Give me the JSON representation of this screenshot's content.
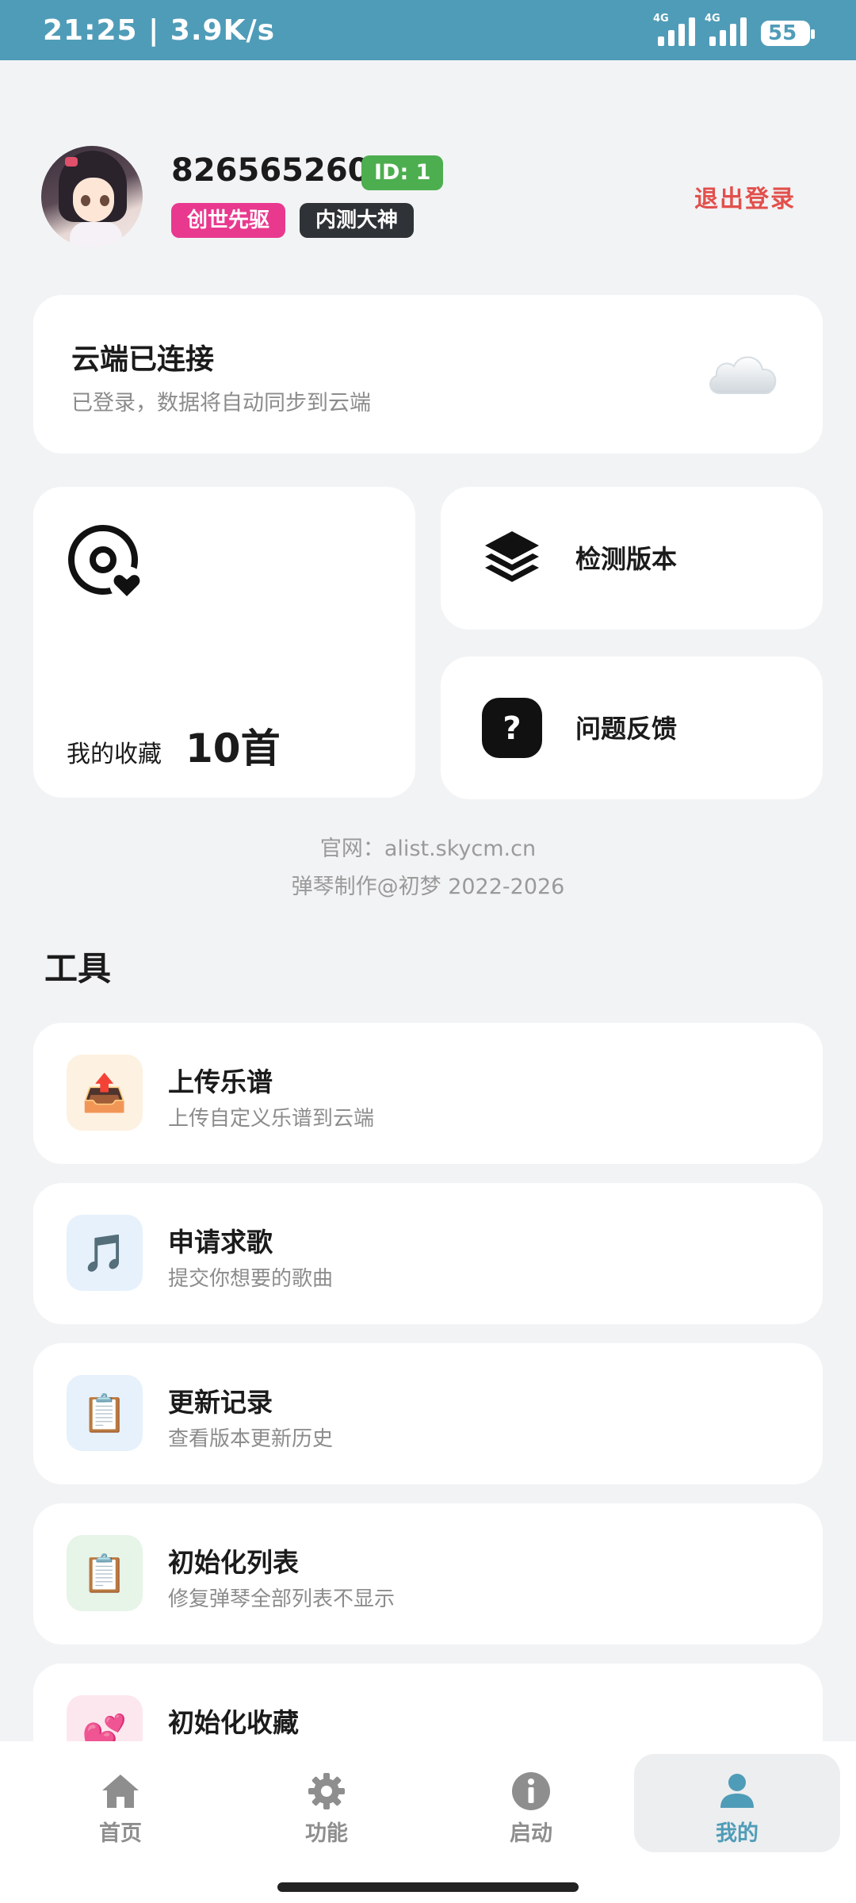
{
  "status_bar": {
    "time": "21:25 | 3.9K/s",
    "network_1": "4G",
    "network_2": "4G",
    "battery": "55"
  },
  "profile": {
    "username": "826565260",
    "id_badge": "ID: 1",
    "badges": [
      "创世先驱",
      "内测大神"
    ],
    "logout_label": "退出登录"
  },
  "cloud": {
    "title": "云端已连接",
    "subtitle": "已登录，数据将自动同步到云端"
  },
  "favorites": {
    "label": "我的收藏",
    "count": "10首"
  },
  "quick_actions": {
    "check_version": "检测版本",
    "feedback": "问题反馈"
  },
  "footer": {
    "website": "官网：alist.skycm.cn",
    "copyright": "弹琴制作@初梦 2022-2026"
  },
  "tools": {
    "section_title": "工具",
    "items": [
      {
        "title": "上传乐谱",
        "subtitle": "上传自定义乐谱到云端",
        "icon": "📤",
        "bg": "#fdf1e2"
      },
      {
        "title": "申请求歌",
        "subtitle": "提交你想要的歌曲",
        "icon": "🎵",
        "bg": "#e6f1fb"
      },
      {
        "title": "更新记录",
        "subtitle": "查看版本更新历史",
        "icon": "📋",
        "bg": "#e6f1fb"
      },
      {
        "title": "初始化列表",
        "subtitle": "修复弹琴全部列表不显示",
        "icon": "📋",
        "bg": "#e7f4e8"
      },
      {
        "title": "初始化收藏",
        "subtitle": "",
        "icon": "💕",
        "bg": "#fde7ef"
      }
    ]
  },
  "tabbar": {
    "tabs": [
      {
        "label": "首页",
        "icon": "home-icon"
      },
      {
        "label": "功能",
        "icon": "gear-icon"
      },
      {
        "label": "启动",
        "icon": "info-icon"
      },
      {
        "label": "我的",
        "icon": "person-icon"
      }
    ],
    "active_index": 3,
    "accent": "#4f9cb8"
  }
}
